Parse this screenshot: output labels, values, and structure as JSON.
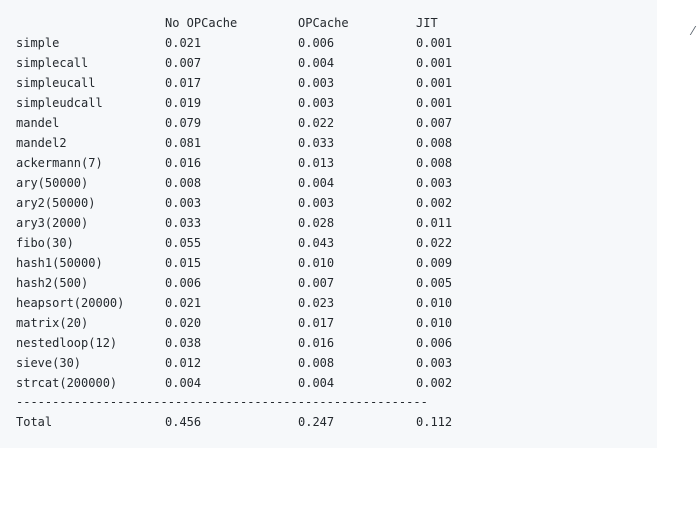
{
  "table": {
    "headers": [
      "",
      "No OPCache",
      "OPCache",
      "JIT"
    ],
    "rows": [
      [
        "simple",
        "0.021",
        "0.006",
        "0.001"
      ],
      [
        "simplecall",
        "0.007",
        "0.004",
        "0.001"
      ],
      [
        "simpleucall",
        "0.017",
        "0.003",
        "0.001"
      ],
      [
        "simpleudcall",
        "0.019",
        "0.003",
        "0.001"
      ],
      [
        "mandel",
        "0.079",
        "0.022",
        "0.007"
      ],
      [
        "mandel2",
        "0.081",
        "0.033",
        "0.008"
      ],
      [
        "ackermann(7)",
        "0.016",
        "0.013",
        "0.008"
      ],
      [
        "ary(50000)",
        "0.008",
        "0.004",
        "0.003"
      ],
      [
        "ary2(50000)",
        "0.003",
        "0.003",
        "0.002"
      ],
      [
        "ary3(2000)",
        "0.033",
        "0.028",
        "0.011"
      ],
      [
        "fibo(30)",
        "0.055",
        "0.043",
        "0.022"
      ],
      [
        "hash1(50000)",
        "0.015",
        "0.010",
        "0.009"
      ],
      [
        "hash2(500)",
        "0.006",
        "0.007",
        "0.005"
      ],
      [
        "heapsort(20000)",
        "0.021",
        "0.023",
        "0.010"
      ],
      [
        "matrix(20)",
        "0.020",
        "0.017",
        "0.010"
      ],
      [
        "nestedloop(12)",
        "0.038",
        "0.016",
        "0.006"
      ],
      [
        "sieve(30)",
        "0.012",
        "0.008",
        "0.003"
      ],
      [
        "strcat(200000)",
        "0.004",
        "0.004",
        "0.002"
      ]
    ],
    "separator": "---------------------------------------------------------",
    "total": [
      "Total",
      "0.456",
      "0.247",
      "0.112"
    ]
  }
}
